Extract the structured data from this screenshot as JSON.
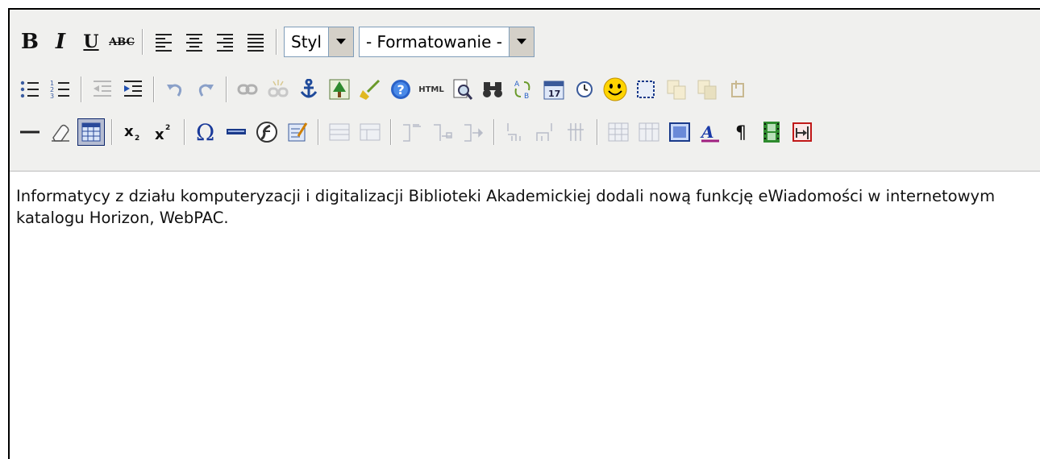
{
  "toolbar": {
    "style_select": {
      "value": "Styl"
    },
    "format_select": {
      "value": "- Formatowanie -"
    }
  },
  "icons": {
    "bold": "bold-icon",
    "italic": "italic-icon",
    "underline": "underline-icon",
    "strikethrough": "strikethrough-icon",
    "align_left": "align-left-icon",
    "align_center": "align-center-icon",
    "align_right": "align-right-icon",
    "align_justify": "align-justify-icon",
    "html_label": "HTML"
  },
  "bold_letter": "B",
  "italic_letter": "I",
  "underline_letter": "U",
  "strike_letters": "ABC",
  "content": {
    "text": "Informatycy z działu komputeryzacji i digitalizacji Biblioteki Akademickiej dodali nową funkcję eWiadomości w internetowym katalogu Horizon, WebPAC."
  }
}
